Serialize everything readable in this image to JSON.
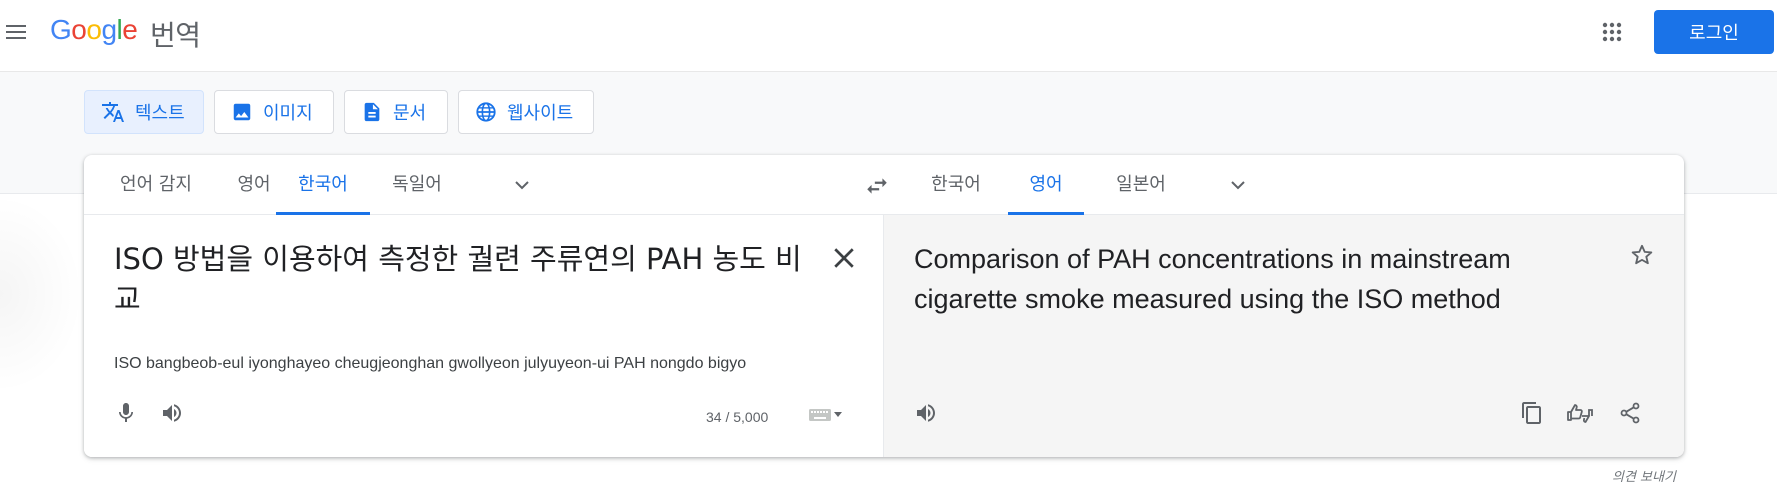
{
  "header": {
    "logo_word": "Google",
    "product_name": "번역",
    "login_label": "로그인",
    "colors": {
      "google_blue": "#4285F4",
      "google_red": "#EA4335",
      "google_yellow": "#FBBC05",
      "google_green": "#34A853",
      "accent": "#1a73e8"
    }
  },
  "modes": [
    {
      "label": "텍스트",
      "icon": "translate-icon",
      "active": true
    },
    {
      "label": "이미지",
      "icon": "image-icon",
      "active": false
    },
    {
      "label": "문서",
      "icon": "document-icon",
      "active": false
    },
    {
      "label": "웹사이트",
      "icon": "globe-icon",
      "active": false
    }
  ],
  "source": {
    "languages": [
      "언어 감지",
      "영어",
      "한국어",
      "독일어"
    ],
    "selected": "한국어",
    "text": "ISO 방법을 이용하여 측정한 궐련 주류연의 PAH 농도 비교",
    "transliteration": "ISO bangbeob-eul iyonghayeo cheugjeonghan gwollyeon julyuyeon-ui PAH nongdo bigyo",
    "char_count": "34 / 5,000"
  },
  "target": {
    "languages": [
      "한국어",
      "영어",
      "일본어"
    ],
    "selected": "영어",
    "text": "Comparison of PAH concentrations in mainstream cigarette smoke measured using the ISO method"
  },
  "footer": {
    "feedback_label": "의견 보내기"
  }
}
